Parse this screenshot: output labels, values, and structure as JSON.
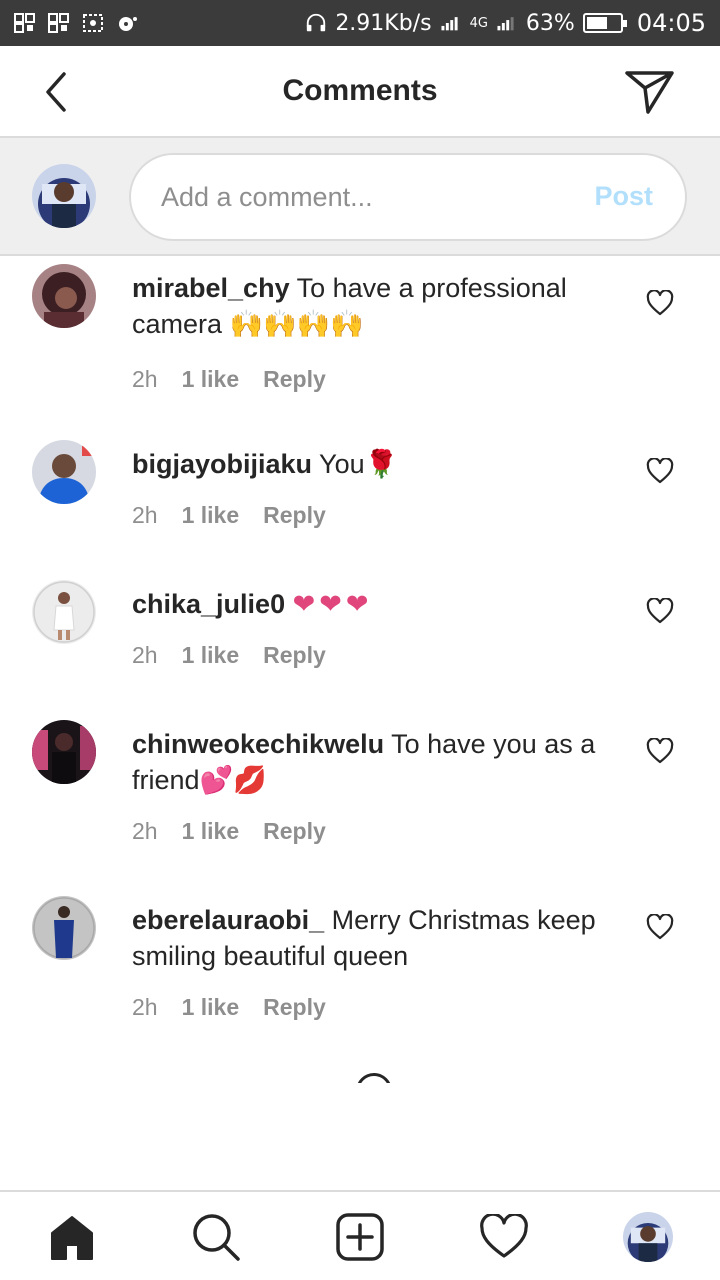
{
  "status_bar": {
    "speed": "2.91Kb/s",
    "network": "4G",
    "battery": "63%",
    "battery_level": 0.63,
    "time": "04:05"
  },
  "header": {
    "title": "Comments",
    "back_icon": "chevron-left-icon",
    "send_icon": "paper-plane-icon"
  },
  "composer": {
    "placeholder": "Add a comment...",
    "value": "",
    "post_label": "Post"
  },
  "comments": [
    {
      "username": "mirabel_chy",
      "text": " To have a professional camera ",
      "emoji": "🙌🙌🙌🙌",
      "time": "2h",
      "likes": "1 like",
      "reply": "Reply",
      "avatar_color": "#6b3b3f"
    },
    {
      "username": "bigjayobijiaku",
      "text": " You",
      "emoji": "🌹",
      "time": "2h",
      "likes": "1 like",
      "reply": "Reply",
      "avatar_color": "#1d63d6"
    },
    {
      "username": "chika_julie0",
      "text": " ",
      "emoji": "❤❤❤",
      "time": "2h",
      "likes": "1 like",
      "reply": "Reply",
      "avatar_color": "#e6e6e6"
    },
    {
      "username": "chinweokechikwelu",
      "text": " To have you as a friend",
      "emoji": "💕💋",
      "time": "2h",
      "likes": "1 like",
      "reply": "Reply",
      "avatar_color": "#2a1a22"
    },
    {
      "username": "eberelauraobi_",
      "text": " Merry Christmas keep smiling beautiful queen",
      "emoji": "",
      "time": "2h",
      "likes": "1 like",
      "reply": "Reply",
      "avatar_color": "#bfbfbf"
    }
  ],
  "bottom_nav": {
    "items": [
      "home-icon",
      "search-icon",
      "add-post-icon",
      "heart-icon",
      "profile-avatar"
    ]
  },
  "colors": {
    "status_bar_bg": "#3b3b3b",
    "post_disabled": "#b2dffc",
    "meta_text": "#8e8e8e",
    "primary_text": "#262626",
    "emoji_hearts": "#e0457b"
  }
}
